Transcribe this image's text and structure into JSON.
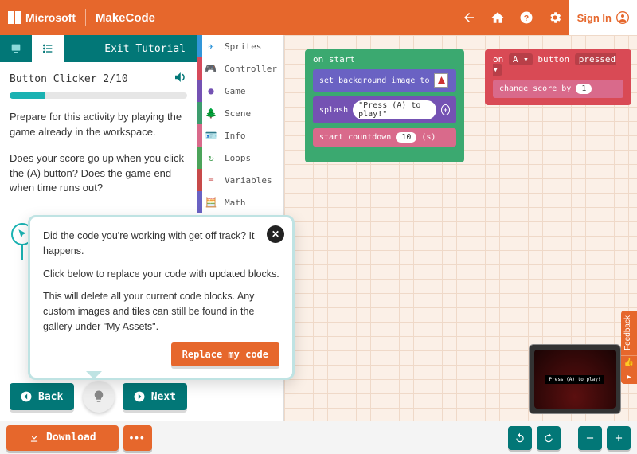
{
  "header": {
    "org": "Microsoft",
    "brand": "MakeCode",
    "sign_in": "Sign In"
  },
  "tutorial": {
    "exit": "Exit Tutorial",
    "title": "Button Clicker 2/10",
    "progress_percent": 20,
    "para1": "Prepare for this activity by playing the game already in the workspace.",
    "para2": "Does your score go up when you click the (A) button? Does the game end when time runs out?",
    "replace_link": "Replace my code",
    "back": "Back",
    "next": "Next"
  },
  "popup": {
    "l1": "Did the code you're working with get off track? It happens.",
    "l2": "Click below to replace your code with updated blocks.",
    "l3": "This will delete all your current code blocks. Any custom images and tiles can still be found in the gallery under \"My Assets\".",
    "button": "Replace my code"
  },
  "toolbox": {
    "cats": [
      {
        "label": "Sprites",
        "color": "#3296D9",
        "icon": "send"
      },
      {
        "label": "Controller",
        "color": "#D64A5B",
        "icon": "gamepad"
      },
      {
        "label": "Game",
        "color": "#7452B3",
        "icon": "circle"
      },
      {
        "label": "Scene",
        "color": "#3E9C6E",
        "icon": "tree"
      },
      {
        "label": "Info",
        "color": "#D96A8B",
        "icon": "id"
      },
      {
        "label": "Loops",
        "color": "#4CA35A",
        "icon": "loop"
      },
      {
        "label": "Variables",
        "color": "#C74A4A",
        "icon": "bars"
      },
      {
        "label": "Math",
        "color": "#6A62C3",
        "icon": "calc"
      }
    ]
  },
  "blocks": {
    "on_start": {
      "hat": "on start",
      "set_bg": "set background image to",
      "splash": "splash",
      "splash_val": "\"Press (A) to play!\"",
      "countdown": "start countdown",
      "countdown_num": "10",
      "countdown_unit": "(s)"
    },
    "on_button": {
      "hat_1": "on",
      "hat_btn": "A ▾",
      "hat_2": "button",
      "hat_evt": "pressed ▾",
      "change": "change score by",
      "change_val": "1"
    }
  },
  "sim": {
    "text": "Press (A) to play!"
  },
  "feedback": {
    "label": "Feedback"
  },
  "footer": {
    "download": "Download"
  }
}
